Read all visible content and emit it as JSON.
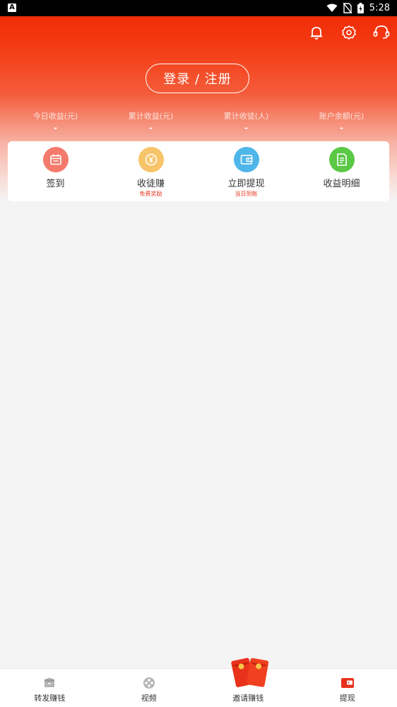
{
  "status": {
    "left_glyph": "A",
    "time": "5:28"
  },
  "header": {
    "icons": [
      "bell-icon",
      "gear-icon",
      "headset-icon"
    ],
    "login_label": "登录 / 注册",
    "stats": [
      {
        "label": "今日收益(元)",
        "value": "-"
      },
      {
        "label": "累计收益(元)",
        "value": "-"
      },
      {
        "label": "累计收徒(人)",
        "value": "-"
      },
      {
        "label": "账户余额(元)",
        "value": "-"
      }
    ]
  },
  "actions": [
    {
      "label": "签到",
      "sub": "",
      "icon": "calendar-icon",
      "color": "#f47a6b"
    },
    {
      "label": "收徒赚",
      "sub": "免费奖励",
      "icon": "coin-icon",
      "color": "#f8c46a"
    },
    {
      "label": "立即提现",
      "sub": "当日到账",
      "icon": "wallet-icon",
      "color": "#4fb6ea"
    },
    {
      "label": "收益明细",
      "sub": "",
      "icon": "document-icon",
      "color": "#5bc846"
    }
  ],
  "tabs": [
    {
      "label": "转发赚钱",
      "icon": "share-box-icon"
    },
    {
      "label": "视频",
      "icon": "video-icon"
    },
    {
      "label": "邀请赚钱",
      "icon": "red-envelope-icon"
    },
    {
      "label": "提现",
      "icon": "wallet-icon"
    }
  ],
  "colors": {
    "brand": "#f22d08",
    "accent_text": "#e8341c"
  }
}
